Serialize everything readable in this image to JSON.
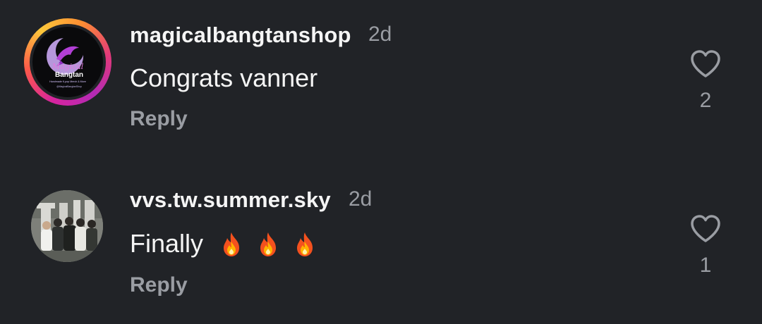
{
  "comments": [
    {
      "username": "magicalbangtanshop",
      "time": "2d",
      "text": "Congrats vanner",
      "emojis": [],
      "reply_label": "Reply",
      "like_count": "2",
      "avatar": {
        "type": "logo",
        "lines": [
          "Magical",
          "Bangtan",
          "Handmade K-pop Merch & More",
          "@MagicalBangtanShop"
        ]
      }
    },
    {
      "username": "vvs.tw.summer.sky",
      "time": "2d",
      "text": "Finally",
      "emojis": [
        "fire-icon",
        "fire-icon",
        "fire-icon"
      ],
      "reply_label": "Reply",
      "like_count": "1",
      "avatar": {
        "type": "photo"
      }
    }
  ],
  "colors": {
    "background": "#212327",
    "text_primary": "#f5f5f5",
    "text_secondary": "#9a9da3",
    "story_ring": "#d6249f"
  }
}
